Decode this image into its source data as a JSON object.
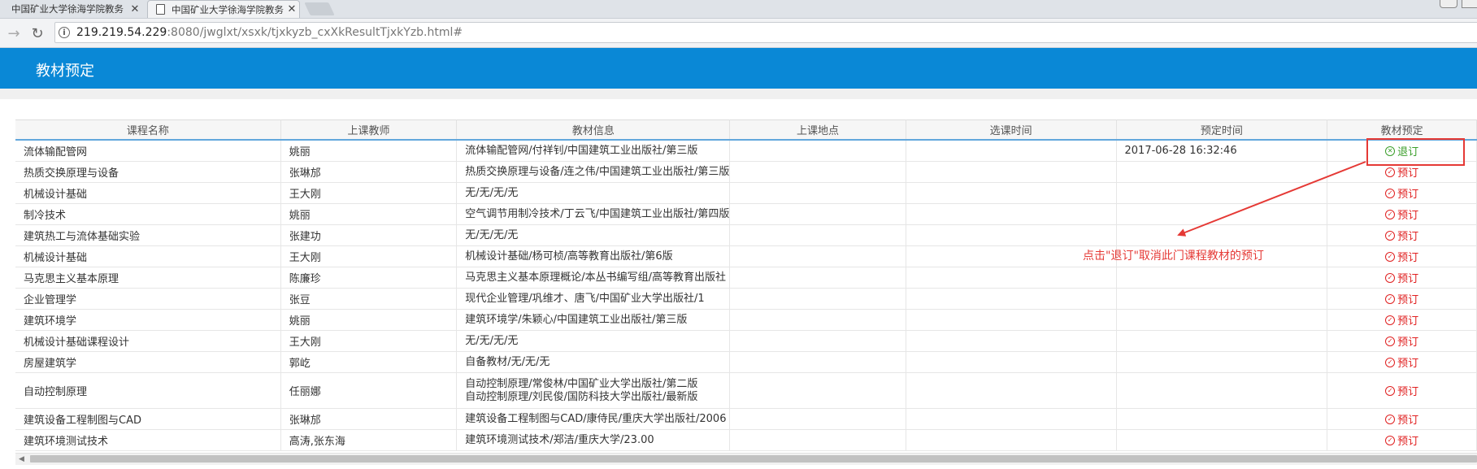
{
  "browser": {
    "tabs": [
      {
        "title": "中国矿业大学徐海学院教务"
      },
      {
        "title": "中国矿业大学徐海学院教务"
      }
    ],
    "address": {
      "host": "219.219.54.229",
      "path": ":8080/jwglxt/xsxk/tjxkyzb_cxXkResultTjxkYzb.html#"
    }
  },
  "page": {
    "title": "教材预定"
  },
  "table": {
    "headers": [
      "课程名称",
      "上课教师",
      "教材信息",
      "上课地点",
      "选课时间",
      "预定时间",
      "教材预定"
    ],
    "rows": [
      {
        "course": "流体输配管网",
        "teacher": "姚丽",
        "book": [
          "流体输配管网/付祥钊/中国建筑工业出版社/第三版"
        ],
        "location": "",
        "select_time": "",
        "reserve_time": "2017-06-28 16:32:46",
        "action": "退订",
        "action_type": "cancel"
      },
      {
        "course": "热质交换原理与设备",
        "teacher": "张琳邡",
        "book": [
          "热质交换原理与设备/连之伟/中国建筑工业出版社/第三版"
        ],
        "location": "",
        "select_time": "",
        "reserve_time": "",
        "action": "预订",
        "action_type": "reserve"
      },
      {
        "course": "机械设计基础",
        "teacher": "王大刚",
        "book": [
          "无/无/无/无"
        ],
        "location": "",
        "select_time": "",
        "reserve_time": "",
        "action": "预订",
        "action_type": "reserve"
      },
      {
        "course": "制冷技术",
        "teacher": "姚丽",
        "book": [
          "空气调节用制冷技术/丁云飞/中国建筑工业出版社/第四版"
        ],
        "location": "",
        "select_time": "",
        "reserve_time": "",
        "action": "预订",
        "action_type": "reserve"
      },
      {
        "course": "建筑热工与流体基础实验",
        "teacher": "张建功",
        "book": [
          "无/无/无/无"
        ],
        "location": "",
        "select_time": "",
        "reserve_time": "",
        "action": "预订",
        "action_type": "reserve"
      },
      {
        "course": "机械设计基础",
        "teacher": "王大刚",
        "book": [
          "机械设计基础/杨可桢/高等教育出版社/第6版"
        ],
        "location": "",
        "select_time": "",
        "reserve_time": "",
        "action": "预订",
        "action_type": "reserve"
      },
      {
        "course": "马克思主义基本原理",
        "teacher": "陈廉珍",
        "book": [
          "马克思主义基本原理概论/本丛书编写组/高等教育出版社"
        ],
        "location": "",
        "select_time": "",
        "reserve_time": "",
        "action": "预订",
        "action_type": "reserve"
      },
      {
        "course": "企业管理学",
        "teacher": "张豆",
        "book": [
          "现代企业管理/巩维才、唐飞/中国矿业大学出版社/1"
        ],
        "location": "",
        "select_time": "",
        "reserve_time": "",
        "action": "预订",
        "action_type": "reserve"
      },
      {
        "course": "建筑环境学",
        "teacher": "姚丽",
        "book": [
          "建筑环境学/朱颖心/中国建筑工业出版社/第三版"
        ],
        "location": "",
        "select_time": "",
        "reserve_time": "",
        "action": "预订",
        "action_type": "reserve"
      },
      {
        "course": "机械设计基础课程设计",
        "teacher": "王大刚",
        "book": [
          "无/无/无/无"
        ],
        "location": "",
        "select_time": "",
        "reserve_time": "",
        "action": "预订",
        "action_type": "reserve"
      },
      {
        "course": "房屋建筑学",
        "teacher": "郭屹",
        "book": [
          "自备教材/无/无/无"
        ],
        "location": "",
        "select_time": "",
        "reserve_time": "",
        "action": "预订",
        "action_type": "reserve"
      },
      {
        "course": "自动控制原理",
        "teacher": "任丽娜",
        "book": [
          "自动控制原理/常俊林/中国矿业大学出版社/第二版",
          "自动控制原理/刘民俊/国防科技大学出版社/最新版"
        ],
        "location": "",
        "select_time": "",
        "reserve_time": "",
        "action": "预订",
        "action_type": "reserve"
      },
      {
        "course": "建筑设备工程制图与CAD",
        "teacher": "张琳邡",
        "book": [
          "建筑设备工程制图与CAD/康侍民/重庆大学出版社/2006"
        ],
        "location": "",
        "select_time": "",
        "reserve_time": "",
        "action": "预订",
        "action_type": "reserve"
      },
      {
        "course": "建筑环境测试技术",
        "teacher": "高涛,张东海",
        "book": [
          "建筑环境测试技术/郑洁/重庆大学/23.00"
        ],
        "location": "",
        "select_time": "",
        "reserve_time": "",
        "action": "预订",
        "action_type": "reserve"
      }
    ]
  },
  "annotation": {
    "note": "点击\"退订\"取消此门课程教材的预订"
  },
  "colors": {
    "banner": "#0a88d6",
    "reserve": "#e02020",
    "cancel": "#3a9e2a",
    "annotation": "#e53935"
  },
  "icons": {
    "reserve": "check-circle-icon",
    "cancel": "x-circle-icon"
  }
}
